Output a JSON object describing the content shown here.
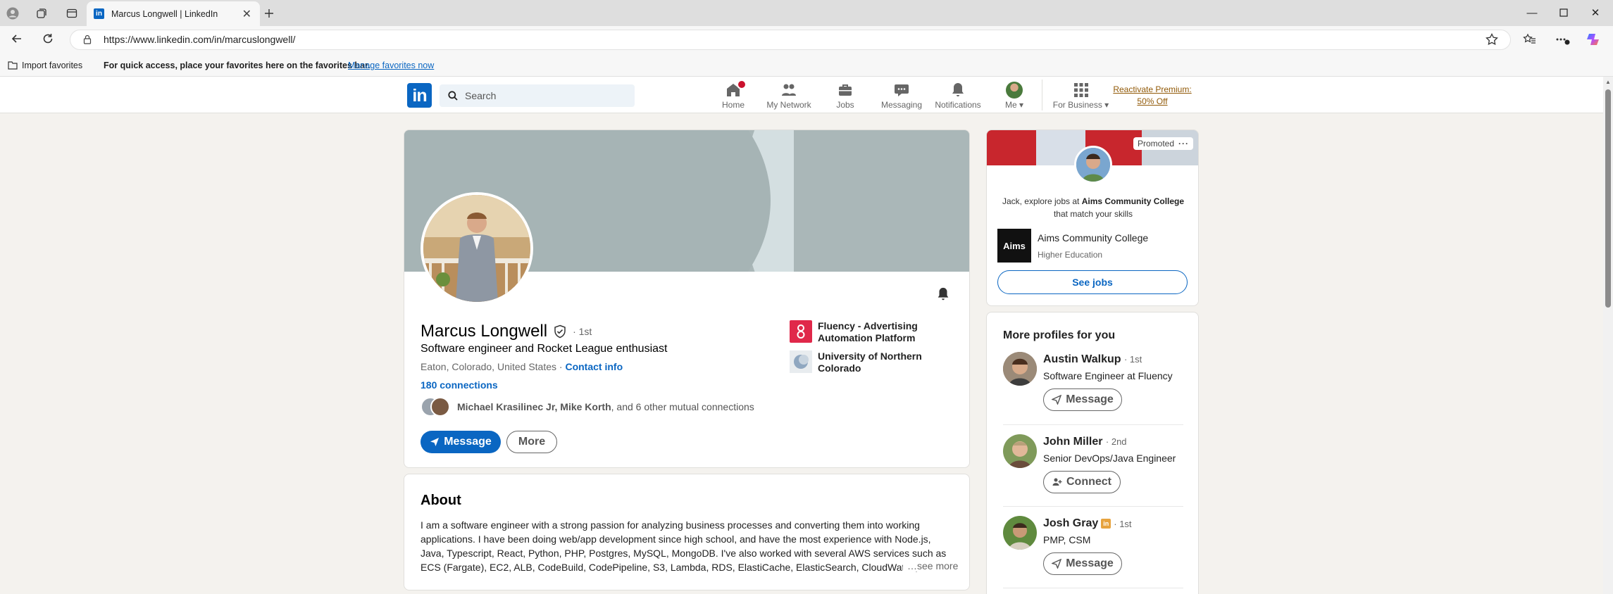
{
  "browser": {
    "tab_title": "Marcus Longwell | LinkedIn",
    "url": "https://www.linkedin.com/in/marcuslongwell/",
    "favorites_bar": {
      "import_label": "Import favorites",
      "message": "For quick access, place your favorites here on the favorites bar.",
      "manage_link": "Manage favorites now"
    }
  },
  "header": {
    "search_placeholder": "Search",
    "nav": {
      "home": "Home",
      "network": "My Network",
      "jobs": "Jobs",
      "messaging": "Messaging",
      "notifications": "Notifications",
      "me": "Me",
      "business": "For Business",
      "premium_line1": "Reactivate Premium:",
      "premium_line2": "50% Off"
    }
  },
  "profile": {
    "name": "Marcus Longwell",
    "degree": "· 1st",
    "headline": "Software engineer and Rocket League enthusiast",
    "location": "Eaton, Colorado, United States",
    "location_sep": "·",
    "contact_info": "Contact info",
    "connections": "180 connections",
    "mutual_names": "Michael Krasilinec Jr, Mike Korth",
    "mutual_rest": ", and 6 other mutual connections",
    "message_button": "Message",
    "more_button": "More",
    "company": "Fluency - Advertising Automation Platform",
    "school": "University of Northern Colorado"
  },
  "about": {
    "title": "About",
    "text": "I am a software engineer with a strong passion for analyzing business processes and converting them into working applications. I have been doing web/app development since high school, and have the most experience with Node.js, Java, Typescript, React, Python, PHP, Postgres, MySQL, MongoDB. I've also worked with several AWS services such as ECS (Fargate), EC2, ALB, CodeBuild, CodePipeline, S3, Lambda, RDS, ElastiCache, ElasticSearch, CloudWatch, and mc",
    "see_more": "…see more"
  },
  "ad": {
    "promoted": "Promoted",
    "text_pre": "Jack, explore jobs at ",
    "text_company": "Aims Community College",
    "text_post": "that match your skills",
    "company_name": "Aims Community College",
    "company_logo_text": "Aims",
    "industry": "Higher Education",
    "cta": "See jobs"
  },
  "more_profiles": {
    "title": "More profiles for you",
    "people": [
      {
        "name": "Austin Walkup",
        "degree": "· 1st",
        "headline": "Software Engineer at Fluency",
        "action": "Message"
      },
      {
        "name": "John Miller",
        "degree": "· 2nd",
        "headline": "Senior DevOps/Java Engineer",
        "action": "Connect"
      },
      {
        "name": "Josh Gray",
        "degree": "· 1st",
        "headline": "PMP, CSM",
        "action": "Message"
      }
    ]
  },
  "colors": {
    "linkedin_blue": "#0a66c2",
    "premium_gold": "#915907",
    "notification_red": "#cb112d"
  }
}
